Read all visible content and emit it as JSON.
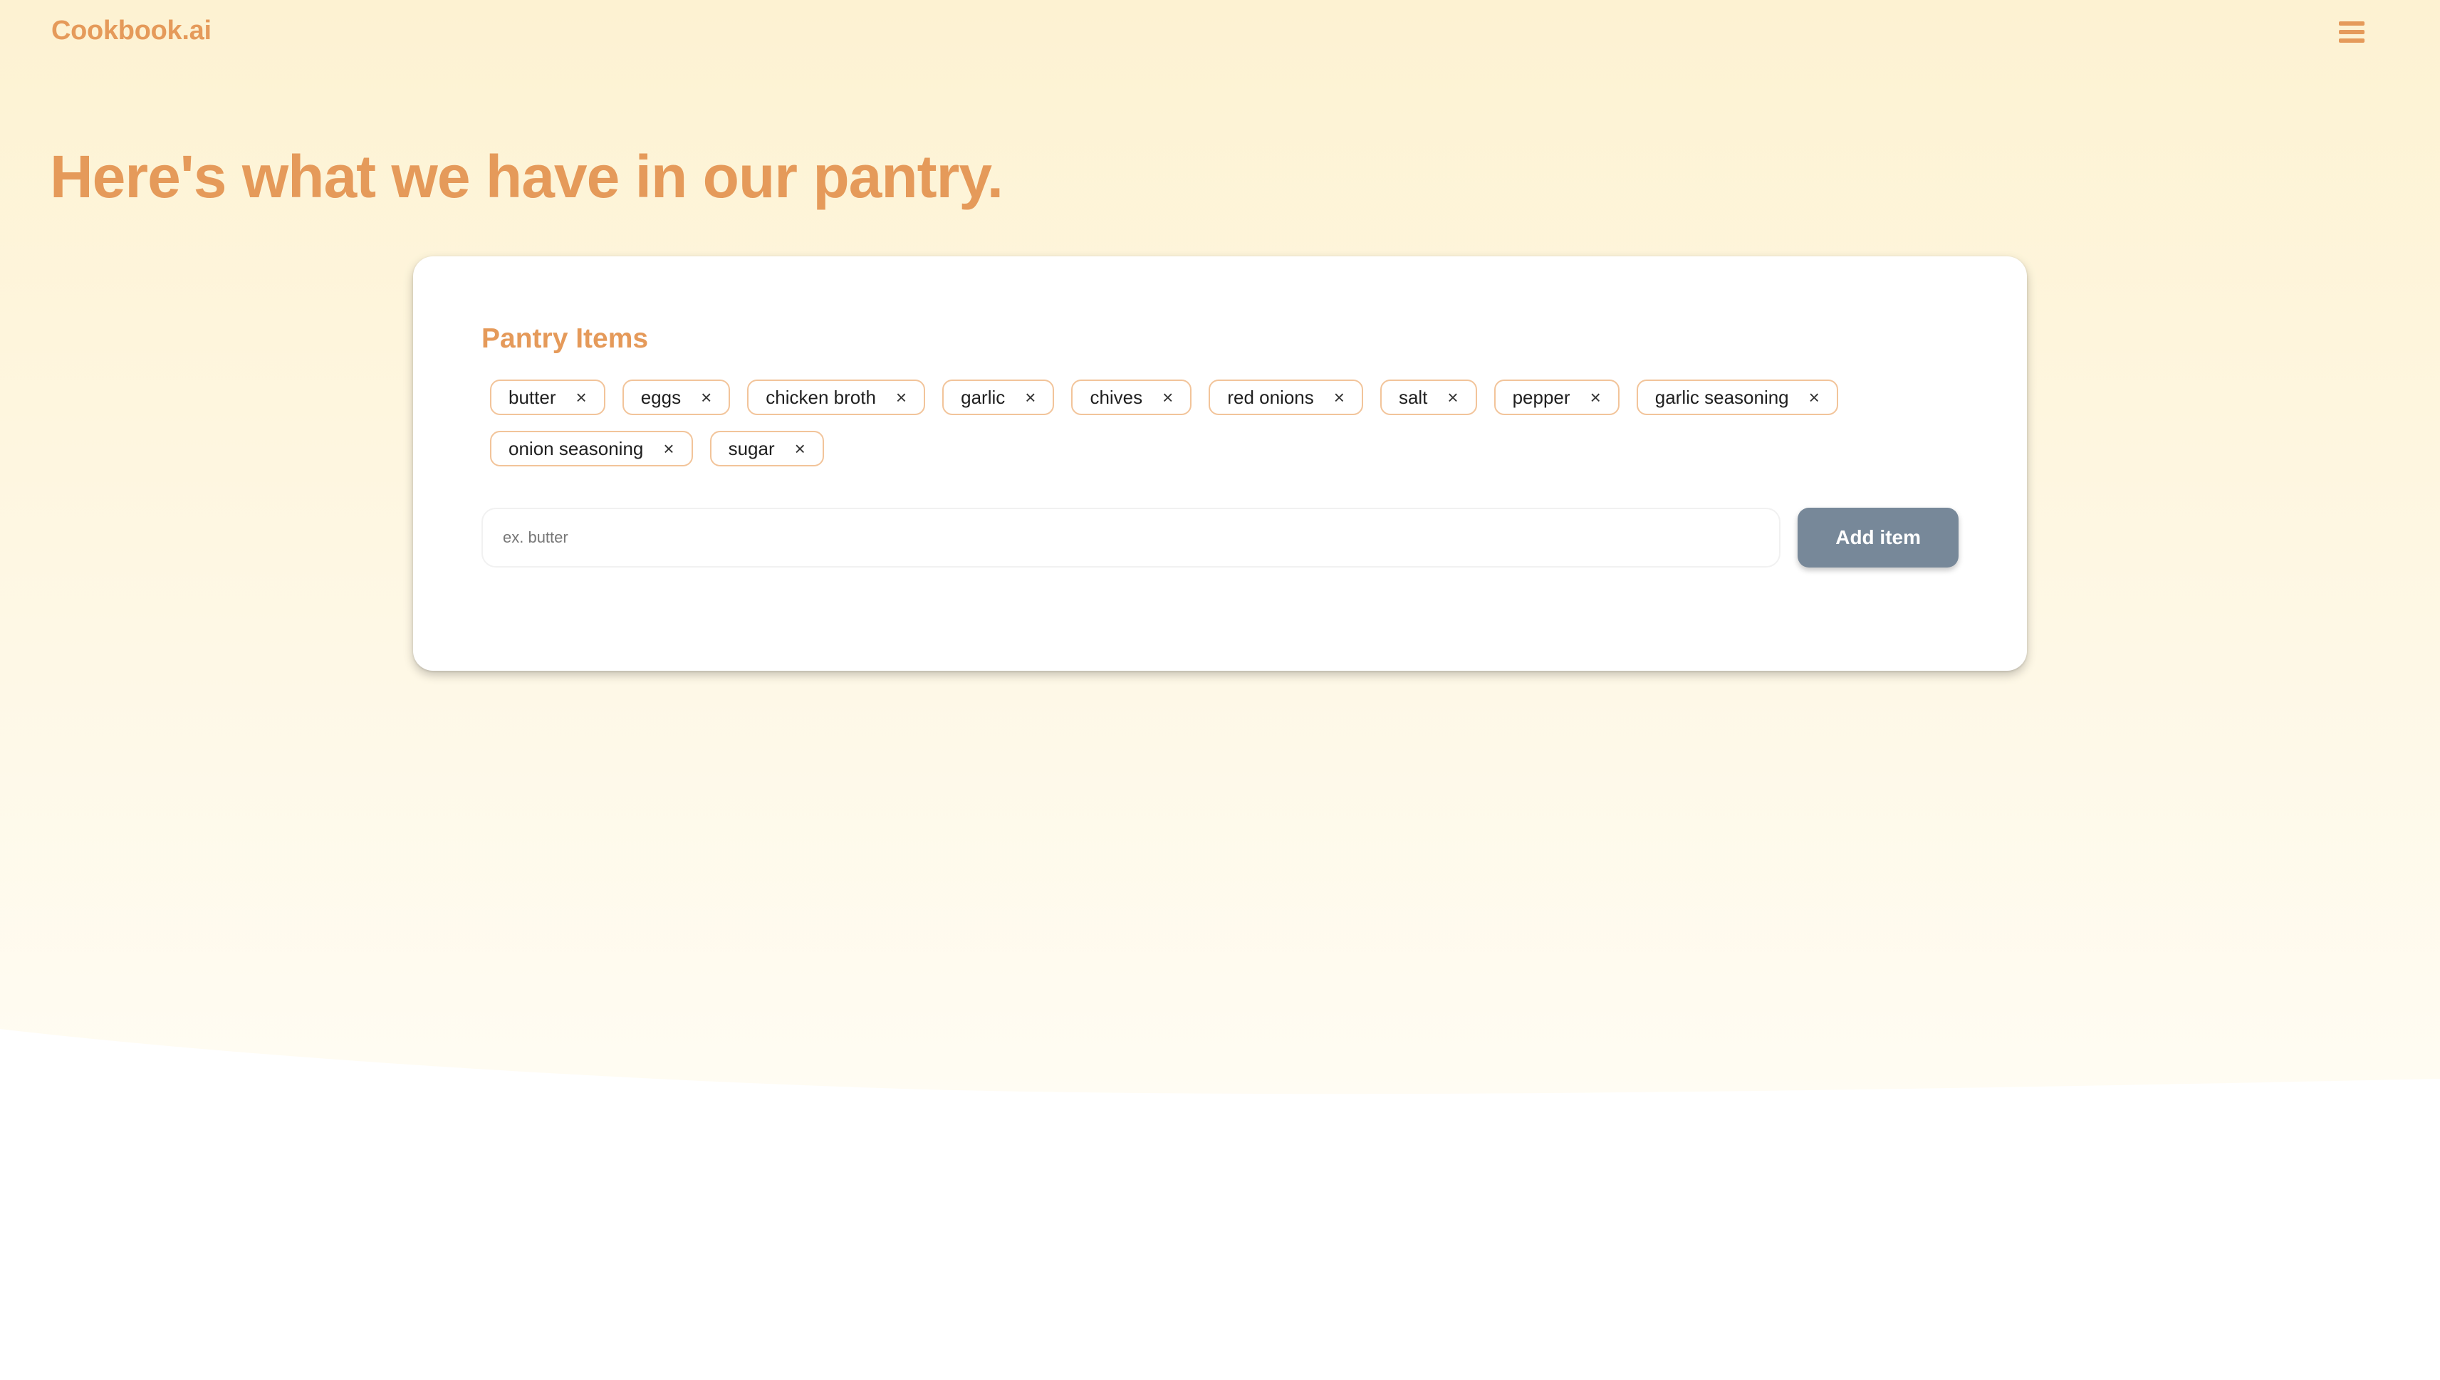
{
  "header": {
    "brand": "Cookbook.ai",
    "menu_icon": "hamburger-menu-icon"
  },
  "hero": {
    "headline": "Here's what we have in our pantry."
  },
  "pantry": {
    "title": "Pantry Items",
    "remove_glyph": "×",
    "items": [
      {
        "label": "butter"
      },
      {
        "label": "eggs"
      },
      {
        "label": "chicken broth"
      },
      {
        "label": "garlic"
      },
      {
        "label": "chives"
      },
      {
        "label": "red onions"
      },
      {
        "label": "salt"
      },
      {
        "label": "pepper"
      },
      {
        "label": "garlic seasoning"
      },
      {
        "label": "onion seasoning"
      },
      {
        "label": "sugar"
      }
    ],
    "input": {
      "value": "",
      "placeholder": "ex. butter"
    },
    "add_button_label": "Add item"
  },
  "colors": {
    "accent": "#e59a5a",
    "button": "#778899",
    "background_top": "#fdf2d2",
    "chip_border": "#f2c49a"
  }
}
